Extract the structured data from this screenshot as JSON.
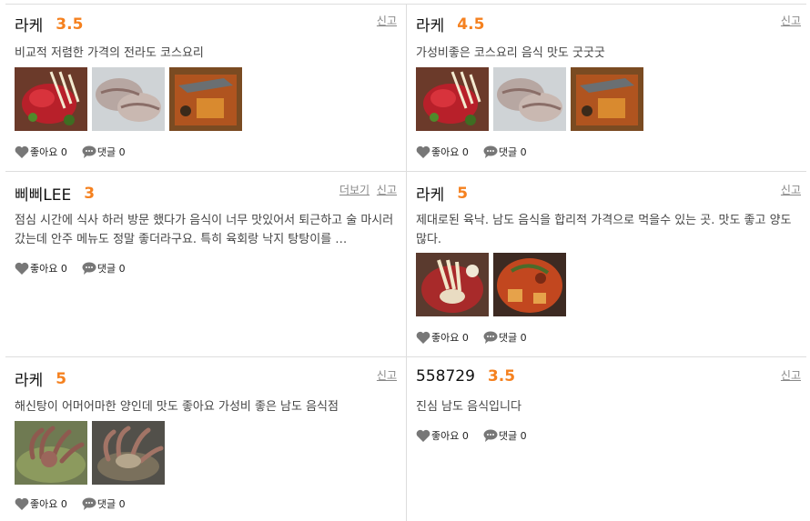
{
  "ui": {
    "report_label": "신고",
    "more_label": "더보기",
    "like_label": "좋아요",
    "comment_label": "댓글"
  },
  "reviews": [
    {
      "author": "라케",
      "score": "3.5",
      "text": "비교적 저렴한 가격의 전라도 코스요리",
      "likes": "0",
      "comments": "0",
      "photos": [
        "raw-beef-dish-photo",
        "boiled-pork-slices-photo",
        "braised-fish-dish-photo"
      ]
    },
    {
      "author": "라케",
      "score": "4.5",
      "text": "가성비좋은 코스요리 음식 맛도 굿굿굿",
      "likes": "0",
      "comments": "0",
      "photos": [
        "raw-beef-dish-photo",
        "boiled-pork-slices-photo",
        "braised-fish-dish-photo"
      ]
    },
    {
      "author": "삐삐LEE",
      "score": "3",
      "text": "점심 시간에 식사 하러 방문 했다가 음식이 너무 맛있어서 퇴근하고 술 마시러 갔는데 안주 메뉴도 정말 좋더라구요. 특히 육회랑 낙지 탕탕이를 …",
      "likes": "0",
      "comments": "0",
      "photos": []
    },
    {
      "author": "라케",
      "score": "5",
      "text": "제대로된 육낙. 남도 음식을 합리적 가격으로 먹을수 있는 곳. 맛도 좋고 양도 많다.",
      "likes": "0",
      "comments": "0",
      "photos": [
        "raw-beef-octopus-photo",
        "braised-seafood-stew-photo"
      ]
    },
    {
      "author": "라케",
      "score": "5",
      "text": "해신탕이 어머어마한 양인데 맛도 좋아요 가성비 좋은 남도 음식점",
      "likes": "0",
      "comments": "0",
      "photos": [
        "octopus-soup-photo",
        "abalone-octopus-photo"
      ]
    },
    {
      "author": "558729",
      "score": "3.5",
      "text": "진심 남도 음식입니다",
      "likes": "0",
      "comments": "0",
      "photos": []
    }
  ],
  "colors": {
    "accent": "#f5811f",
    "divider": "#dddddd",
    "icon": "#777777"
  }
}
